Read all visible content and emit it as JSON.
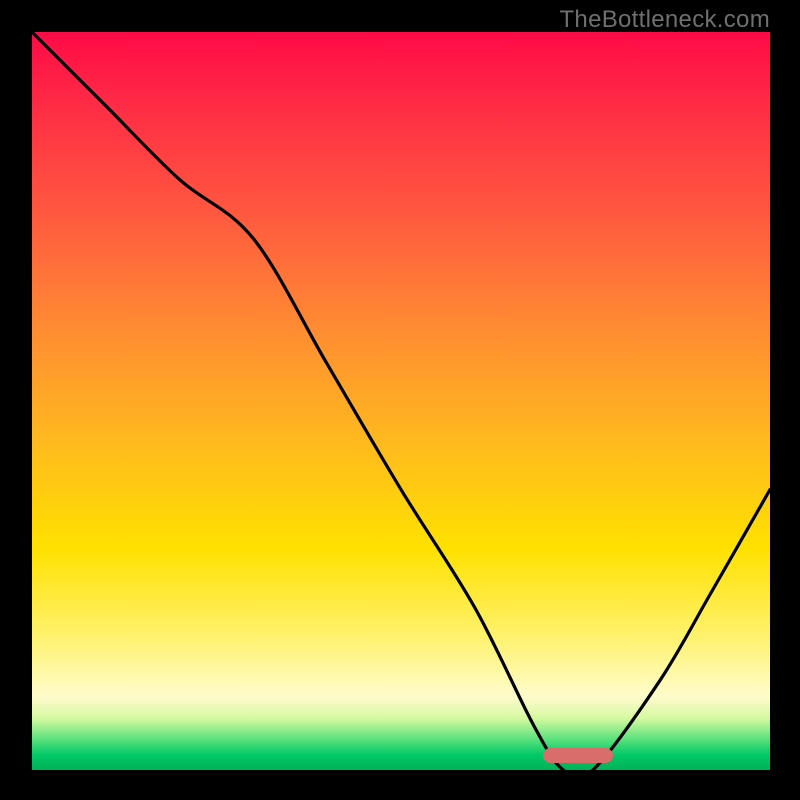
{
  "watermark": {
    "text": "TheBottleneck.com"
  },
  "colors": {
    "curve": "#000000",
    "pill": "#d96d6b",
    "frame_bg": "#000000"
  },
  "chart_data": {
    "type": "line",
    "title": "",
    "xlabel": "",
    "ylabel": "",
    "xlim": [
      0,
      100
    ],
    "ylim": [
      0,
      100
    ],
    "grid": false,
    "series": [
      {
        "name": "bottleneck-curve",
        "x": [
          0,
          10,
          20,
          30,
          40,
          50,
          60,
          68,
          72,
          76,
          85,
          92,
          100
        ],
        "values": [
          100,
          90,
          80,
          72,
          55,
          38,
          22,
          6,
          0,
          0,
          12,
          24,
          38
        ]
      }
    ],
    "annotations": [
      {
        "name": "valley-pill",
        "x": 74,
        "y": 2,
        "width_pct": 9.5,
        "height_pct": 2
      }
    ],
    "background_gradient": "red-orange-yellow-green vertical"
  }
}
